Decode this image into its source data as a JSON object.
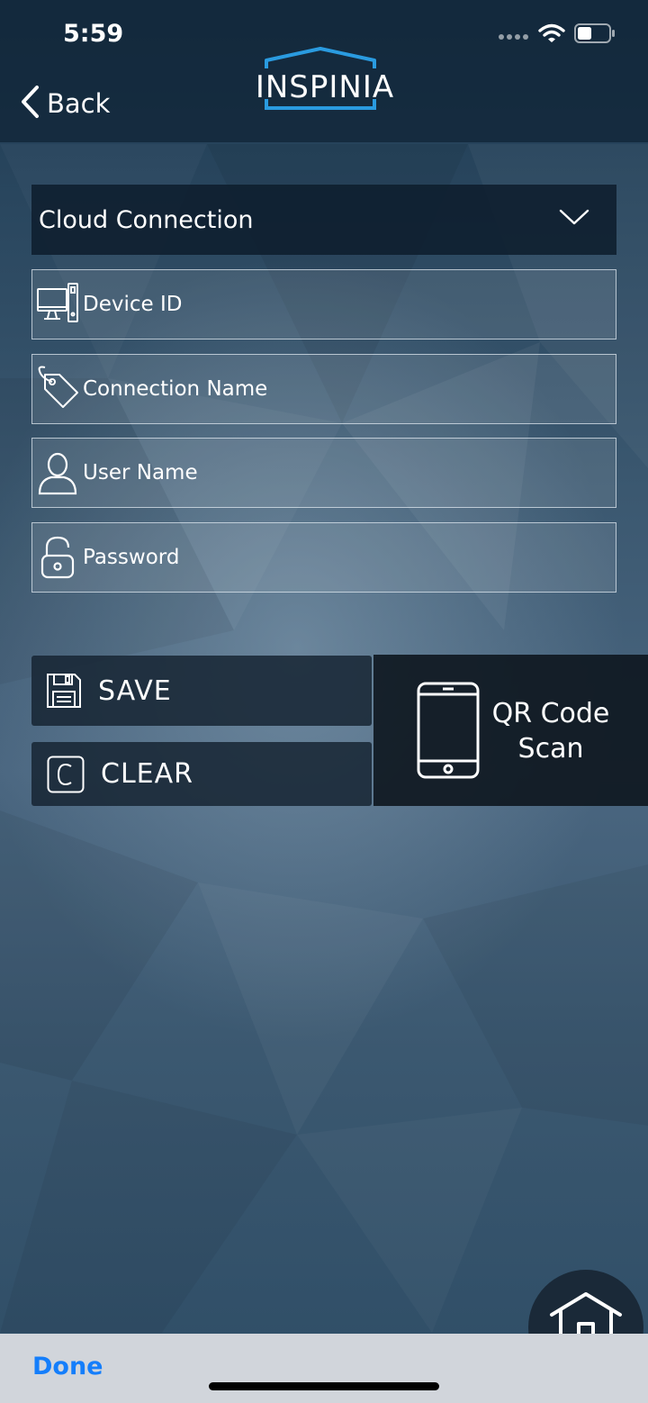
{
  "status_bar": {
    "time": "5:59",
    "icons": [
      "signal-dots-icon",
      "wifi-icon",
      "battery-icon"
    ]
  },
  "header": {
    "back_label": "Back",
    "logo_text": "INSPINIA"
  },
  "connection_type": {
    "selected": "Cloud Connection"
  },
  "form": {
    "device_id": {
      "placeholder": "Device ID",
      "value": "",
      "icon": "computer-icon"
    },
    "connection_name": {
      "placeholder": "Connection Name",
      "value": "",
      "icon": "tag-icon"
    },
    "user_name": {
      "placeholder": "User Name",
      "value": "",
      "icon": "user-icon"
    },
    "password": {
      "placeholder": "Password",
      "value": "",
      "icon": "lock-icon"
    }
  },
  "actions": {
    "save_label": "SAVE",
    "clear_label": "CLEAR",
    "qr_line1": "QR Code",
    "qr_line2": "Scan"
  },
  "keyboard_toolbar": {
    "done_label": "Done"
  },
  "colors": {
    "accent": "#147efb",
    "logo_accent": "#2a9be0",
    "panel_dark": "#0e1e2d"
  }
}
